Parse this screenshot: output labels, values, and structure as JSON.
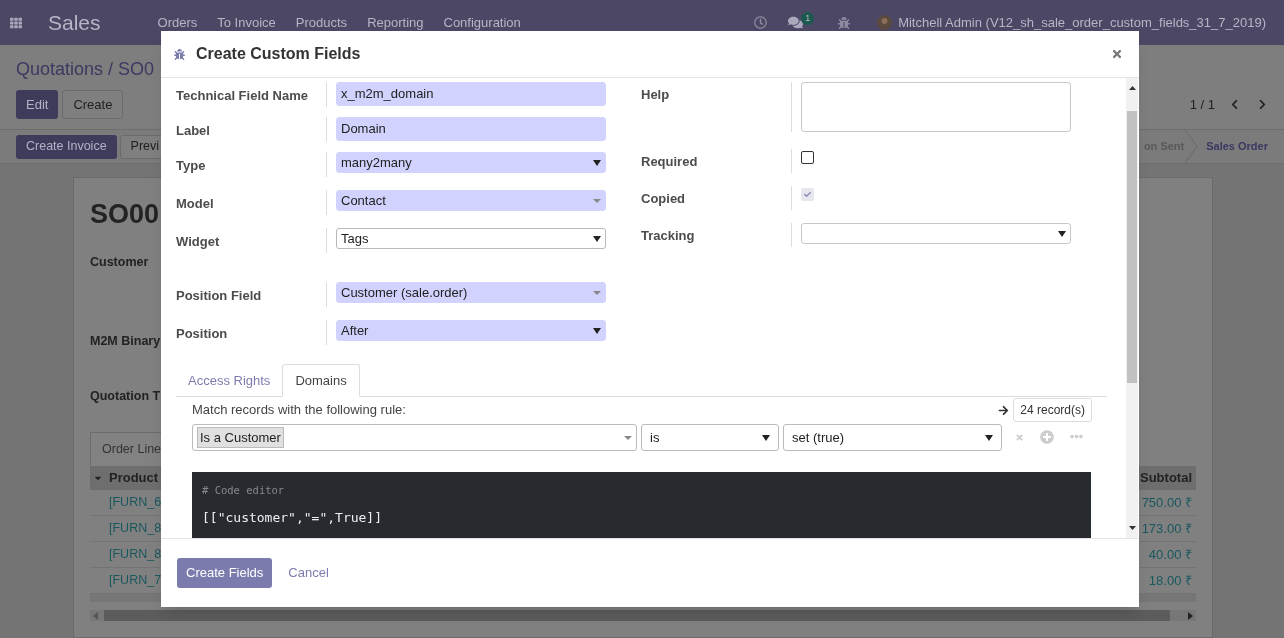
{
  "app_bar": {
    "app": "Sales",
    "menu": [
      "Orders",
      "To Invoice",
      "Products",
      "Reporting",
      "Configuration"
    ],
    "message_count": "1",
    "user": "Mitchell Admin (V12_sh_sale_order_custom_fields_31_7_2019)"
  },
  "control_panel": {
    "breadcrumb": "Quotations / SO0",
    "buttons": [
      {
        "label": "Edit",
        "kind": "primary"
      },
      {
        "label": "Create",
        "kind": "secondary"
      }
    ],
    "pager": "1 / 1"
  },
  "status_bar": {
    "buttons": [
      {
        "label": "Create Invoice",
        "kind": "primary"
      },
      {
        "label": "Previ",
        "kind": "secondary"
      }
    ],
    "stages": [
      {
        "label": "on Sent",
        "selected": false
      },
      {
        "label": "Sales Order",
        "selected": true
      }
    ]
  },
  "sheet": {
    "title": "SO00",
    "fields": [
      "Customer",
      "M2M Binary",
      "Quotation T"
    ],
    "tab": "Order Line",
    "table": {
      "columns": [
        "Product",
        "Subtotal"
      ],
      "rows": [
        [
          "[FURN_6",
          "750.00 ₹"
        ],
        [
          "[FURN_8",
          "173.00 ₹"
        ],
        [
          "[FURN_8",
          "40.00 ₹"
        ],
        [
          "[FURN_7",
          "18.00 ₹"
        ]
      ]
    }
  },
  "dialog": {
    "title": "Create Custom Fields",
    "fields": [
      {
        "label": "Technical Field Name",
        "kind": "text",
        "value": "x_m2m_domain",
        "required": true
      },
      {
        "label": "Label",
        "kind": "text",
        "value": "Domain",
        "required": true
      },
      {
        "label": "Type",
        "kind": "select",
        "value": "many2many",
        "required": true
      },
      {
        "label": "Model",
        "kind": "many2one",
        "value": "Contact",
        "required": true
      },
      {
        "label": "Widget",
        "kind": "select",
        "value": "Tags",
        "required": false
      }
    ],
    "position_fields": [
      {
        "label": "Position Field",
        "kind": "many2one",
        "value": "Customer (sale.order)",
        "required": true
      },
      {
        "label": "Position",
        "kind": "select",
        "value": "After",
        "required": true
      }
    ],
    "options": [
      {
        "label": "Help",
        "kind": "textarea"
      },
      {
        "label": "Required",
        "kind": "checkbox",
        "checked": false,
        "disabled": false
      },
      {
        "label": "Copied",
        "kind": "checkbox",
        "checked": true,
        "disabled": true
      },
      {
        "label": "Tracking",
        "kind": "select"
      }
    ],
    "tabs": [
      {
        "label": "Access Rights",
        "selected": false
      },
      {
        "label": "Domains",
        "selected": true
      }
    ],
    "domain": {
      "intro": "Match records with the following rule:",
      "record_count": "24 record(s)",
      "field": "Is a Customer",
      "operator": "is",
      "value": "set (true)",
      "code_comment": "# Code editor",
      "code": "[[\"customer\",\"=\",True]]"
    },
    "actions": [
      {
        "label": "Create Fields",
        "kind": "primary"
      },
      {
        "label": "Cancel",
        "kind": "link"
      }
    ]
  }
}
